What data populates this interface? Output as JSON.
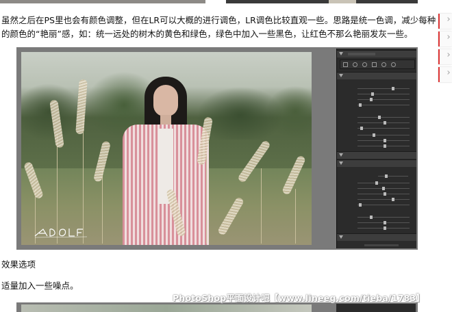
{
  "article": {
    "paragraph": "虽然之后在PS里也会有颜色调整，但在LR可以大概的进行调色，LR调色比较直观一些。思路是统一色调，减少每种的颜色的“艳丽”感，如：统一远处的树木的黄色和绿色，绿色中加入一些黑色，让红色不那么艳丽发灰一些。",
    "caption1": "效果选项",
    "caption2": "适量加入一些噪点。",
    "watermark": "PhotoShop平面设计吧【www.lineeg.com/tieba/1783】"
  },
  "colors": {
    "panel_bg": "#2b2b2b",
    "frame_gray": "#7a7a7a",
    "accent_red": "#dd3333"
  }
}
